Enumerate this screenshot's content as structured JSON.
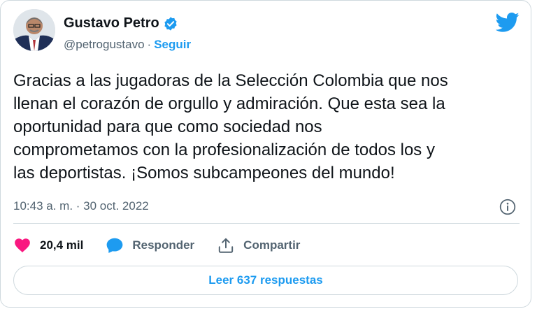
{
  "author": {
    "name": "Gustavo Petro",
    "handle": "@petrogustavo",
    "separator": "·",
    "follow_label": "Seguir"
  },
  "tweet": {
    "text": "Gracias a las jugadoras de la Selección Colombia que nos\nllenan el corazón de orgullo y admiración. Que esta sea la\noportunidad para que como sociedad nos\ncomprometamos con la profesionalización de todos los y\nlas deportistas. ¡Somos subcampeones del mundo!",
    "timestamp": "10:43 a. m. · 30 oct. 2022"
  },
  "actions": {
    "likes_count": "20,4 mil",
    "reply_label": "Responder",
    "share_label": "Compartir"
  },
  "read_replies_label": "Leer 637 respuestas",
  "colors": {
    "accent": "#1d9bf0",
    "like": "#f91880",
    "text": "#0f1419",
    "secondary": "#536471",
    "border": "#cfd9de"
  },
  "icons": [
    "avatar",
    "verified-badge-icon",
    "twitter-bird-icon",
    "info-icon",
    "heart-icon",
    "reply-bubble-icon",
    "share-icon"
  ]
}
